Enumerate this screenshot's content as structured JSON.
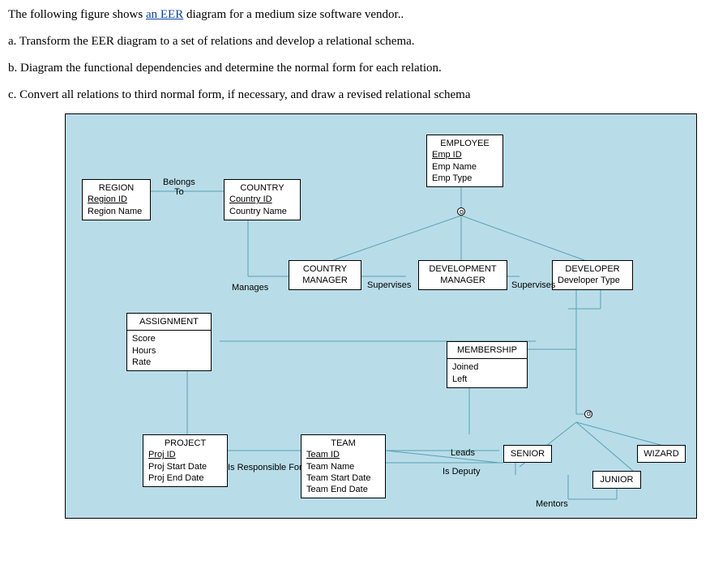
{
  "problem": {
    "intro": "The following figure shows ",
    "link_text": "an  EER",
    "intro_tail": " diagram for a medium size software vendor..",
    "a": "a. Transform the EER diagram to a set of relations and develop a relational schema.",
    "b": "b. Diagram the functional dependencies and determine the normal form for each relation.",
    "c": "c. Convert all relations to third normal form, if necessary, and draw a revised relational schema"
  },
  "entities": {
    "region": {
      "name": "REGION",
      "key": "Region ID",
      "attrs": [
        "Region Name"
      ]
    },
    "country": {
      "name": "COUNTRY",
      "key": "Country ID",
      "attrs": [
        "Country Name"
      ]
    },
    "employee": {
      "name": "EMPLOYEE",
      "key": "Emp ID",
      "attrs": [
        "Emp Name",
        "Emp Type"
      ]
    },
    "country_manager": {
      "name": "COUNTRY\nMANAGER"
    },
    "development_manager": {
      "name": "DEVELOPMENT\nMANAGER"
    },
    "developer": {
      "name": "DEVELOPER",
      "attrs": [
        "Developer Type"
      ]
    },
    "assignment": {
      "name": "ASSIGNMENT",
      "attrs": [
        "Score",
        "Hours",
        "Rate"
      ]
    },
    "project": {
      "name": "PROJECT",
      "key": "Proj ID",
      "attrs": [
        "Proj Start Date",
        "Proj End Date"
      ]
    },
    "team": {
      "name": "TEAM",
      "key": "Team ID",
      "attrs": [
        "Team Name",
        "Team Start Date",
        "Team End Date"
      ]
    },
    "membership": {
      "name": "MEMBERSHIP",
      "attrs": [
        "Joined",
        "Left"
      ]
    },
    "senior": {
      "name": "SENIOR"
    },
    "junior": {
      "name": "JUNIOR"
    },
    "wizard": {
      "name": "WIZARD"
    }
  },
  "relationships": {
    "belongs_to": "Belongs\nTo",
    "manages": "Manages",
    "supervises": "Supervises",
    "supervises2": "Supervises",
    "is_responsible_for": "Is Responsible For",
    "leads": "Leads",
    "is_deputy": "Is Deputy",
    "mentors": "Mentors",
    "d_label": "d",
    "o_label": "o"
  }
}
